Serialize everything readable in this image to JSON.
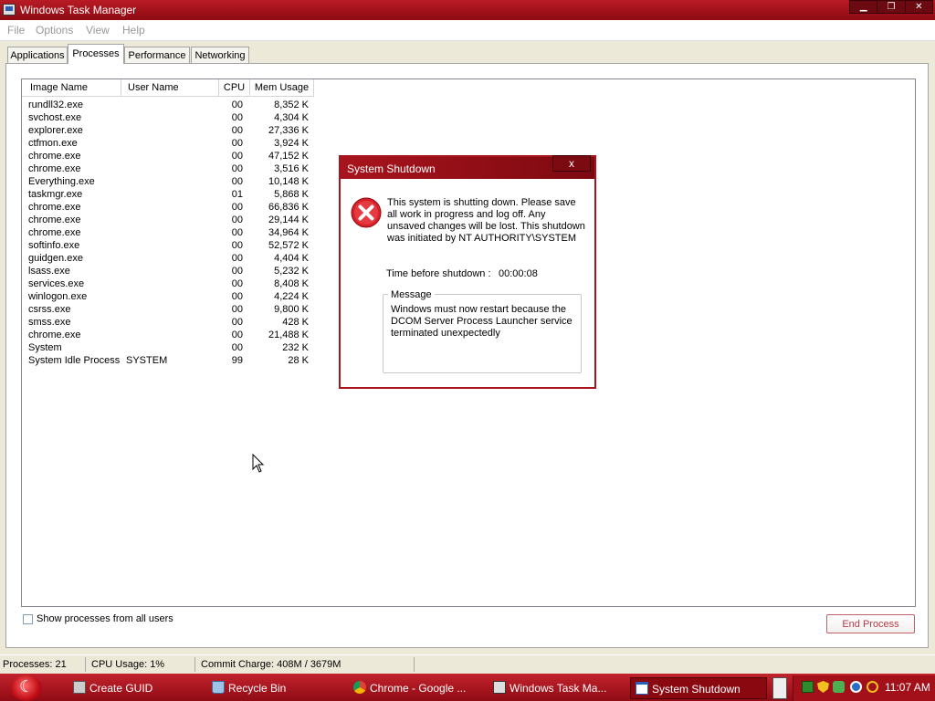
{
  "window": {
    "title": "Windows Task Manager"
  },
  "menu": [
    "File",
    "Options",
    "View",
    "Help"
  ],
  "tabs": [
    "Applications",
    "Processes",
    "Performance",
    "Networking"
  ],
  "active_tab": "Processes",
  "columns": [
    "Image Name",
    "User Name",
    "CPU",
    "Mem Usage"
  ],
  "processes": [
    {
      "name": "rundll32.exe",
      "user": "",
      "cpu": "00",
      "mem": "8,352 K"
    },
    {
      "name": "svchost.exe",
      "user": "",
      "cpu": "00",
      "mem": "4,304 K"
    },
    {
      "name": "explorer.exe",
      "user": "",
      "cpu": "00",
      "mem": "27,336 K"
    },
    {
      "name": "ctfmon.exe",
      "user": "",
      "cpu": "00",
      "mem": "3,924 K"
    },
    {
      "name": "chrome.exe",
      "user": "",
      "cpu": "00",
      "mem": "47,152 K"
    },
    {
      "name": "chrome.exe",
      "user": "",
      "cpu": "00",
      "mem": "3,516 K"
    },
    {
      "name": "Everything.exe",
      "user": "",
      "cpu": "00",
      "mem": "10,148 K"
    },
    {
      "name": "taskmgr.exe",
      "user": "",
      "cpu": "01",
      "mem": "5,868 K"
    },
    {
      "name": "chrome.exe",
      "user": "",
      "cpu": "00",
      "mem": "66,836 K"
    },
    {
      "name": "chrome.exe",
      "user": "",
      "cpu": "00",
      "mem": "29,144 K"
    },
    {
      "name": "chrome.exe",
      "user": "",
      "cpu": "00",
      "mem": "34,964 K"
    },
    {
      "name": "softinfo.exe",
      "user": "",
      "cpu": "00",
      "mem": "52,572 K"
    },
    {
      "name": "guidgen.exe",
      "user": "",
      "cpu": "00",
      "mem": "4,404 K"
    },
    {
      "name": "lsass.exe",
      "user": "",
      "cpu": "00",
      "mem": "5,232 K"
    },
    {
      "name": "services.exe",
      "user": "",
      "cpu": "00",
      "mem": "8,408 K"
    },
    {
      "name": "winlogon.exe",
      "user": "",
      "cpu": "00",
      "mem": "4,224 K"
    },
    {
      "name": "csrss.exe",
      "user": "",
      "cpu": "00",
      "mem": "9,800 K"
    },
    {
      "name": "smss.exe",
      "user": "",
      "cpu": "00",
      "mem": "428 K"
    },
    {
      "name": "chrome.exe",
      "user": "",
      "cpu": "00",
      "mem": "21,488 K"
    },
    {
      "name": "System",
      "user": "",
      "cpu": "00",
      "mem": "232 K"
    },
    {
      "name": "System Idle Process",
      "user": "SYSTEM",
      "cpu": "99",
      "mem": "28 K"
    }
  ],
  "show_all_label": "Show processes from all users",
  "show_all_checked": false,
  "end_process_label": "End Process",
  "status": {
    "processes": "Processes: 21",
    "cpu": "CPU Usage: 1%",
    "commit": "Commit Charge: 408M / 3679M"
  },
  "dialog": {
    "title": "System Shutdown",
    "close": "x",
    "message": "This system is shutting down. Please save all work in progress and log off. Any unsaved changes will be lost. This shutdown was initiated by NT AUTHORITY\\SYSTEM",
    "time_label": "Time before shutdown :",
    "time_value": "00:00:08",
    "group_label": "Message",
    "group_text": "Windows must now restart because the DCOM Server Process Launcher service terminated unexpectedly"
  },
  "taskbar": {
    "items": [
      {
        "label": "Create GUID",
        "icon": "guid-app-icon"
      },
      {
        "label": "Recycle Bin",
        "icon": "recycle-bin-icon"
      },
      {
        "label": "Chrome - Google ...",
        "icon": "chrome-icon"
      },
      {
        "label": "Windows Task Ma...",
        "icon": "task-manager-icon"
      },
      {
        "label": "System Shutdown",
        "icon": "window-icon"
      }
    ],
    "clock": "11:07 AM"
  },
  "colors": {
    "accent": "#a7141d",
    "taskbar": "#b81b25"
  }
}
